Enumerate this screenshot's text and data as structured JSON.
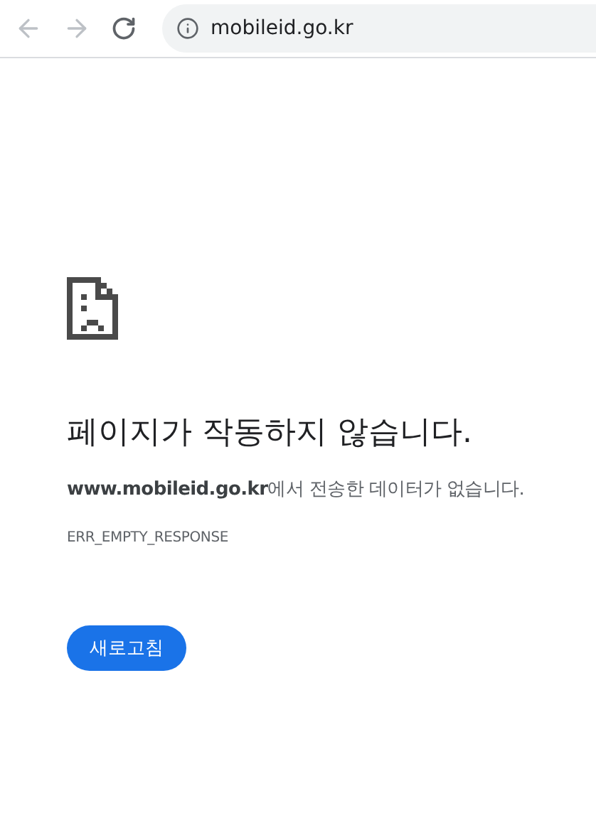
{
  "toolbar": {
    "back": {
      "disabled": true
    },
    "forward": {
      "disabled": true
    },
    "address": "mobileid.go.kr"
  },
  "error": {
    "title": "페이지가 작동하지 않습니다.",
    "description": "**www.mobileid.go.kr**에서 전송한 데이터가 없습니다.",
    "code": "ERR_EMPTY_RESPONSE",
    "button": "새로고침"
  }
}
